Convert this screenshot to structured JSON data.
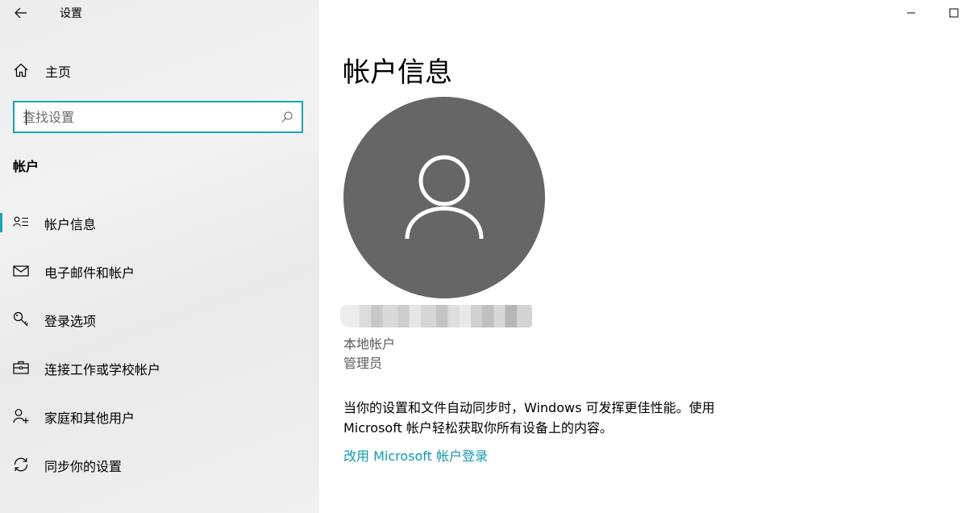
{
  "app": {
    "title": "设置"
  },
  "home": {
    "label": "主页",
    "icon": "home-icon"
  },
  "search": {
    "placeholder": "查找设置",
    "icon": "search-icon"
  },
  "section": {
    "title": "帐户"
  },
  "nav": {
    "items": [
      {
        "label": "帐户信息",
        "icon": "account-info-icon",
        "active": true
      },
      {
        "label": "电子邮件和帐户",
        "icon": "mail-icon",
        "active": false
      },
      {
        "label": "登录选项",
        "icon": "key-icon",
        "active": false
      },
      {
        "label": "连接工作或学校帐户",
        "icon": "briefcase-icon",
        "active": false
      },
      {
        "label": "家庭和其他用户",
        "icon": "add-user-icon",
        "active": false
      },
      {
        "label": "同步你的设置",
        "icon": "sync-icon",
        "active": false
      }
    ]
  },
  "main": {
    "title": "帐户信息",
    "account_type": "本地帐户",
    "role": "管理员",
    "description_line1": "当你的设置和文件自动同步时，Windows 可发挥更佳性能。使用",
    "description_line2": "Microsoft 帐户轻松获取你所有设备上的内容。",
    "link": "改用 Microsoft 帐户登录"
  },
  "colors": {
    "accent": "#14a7b8",
    "link": "#0f9bb0",
    "avatar": "#666666",
    "sidebar": "#efefef"
  }
}
